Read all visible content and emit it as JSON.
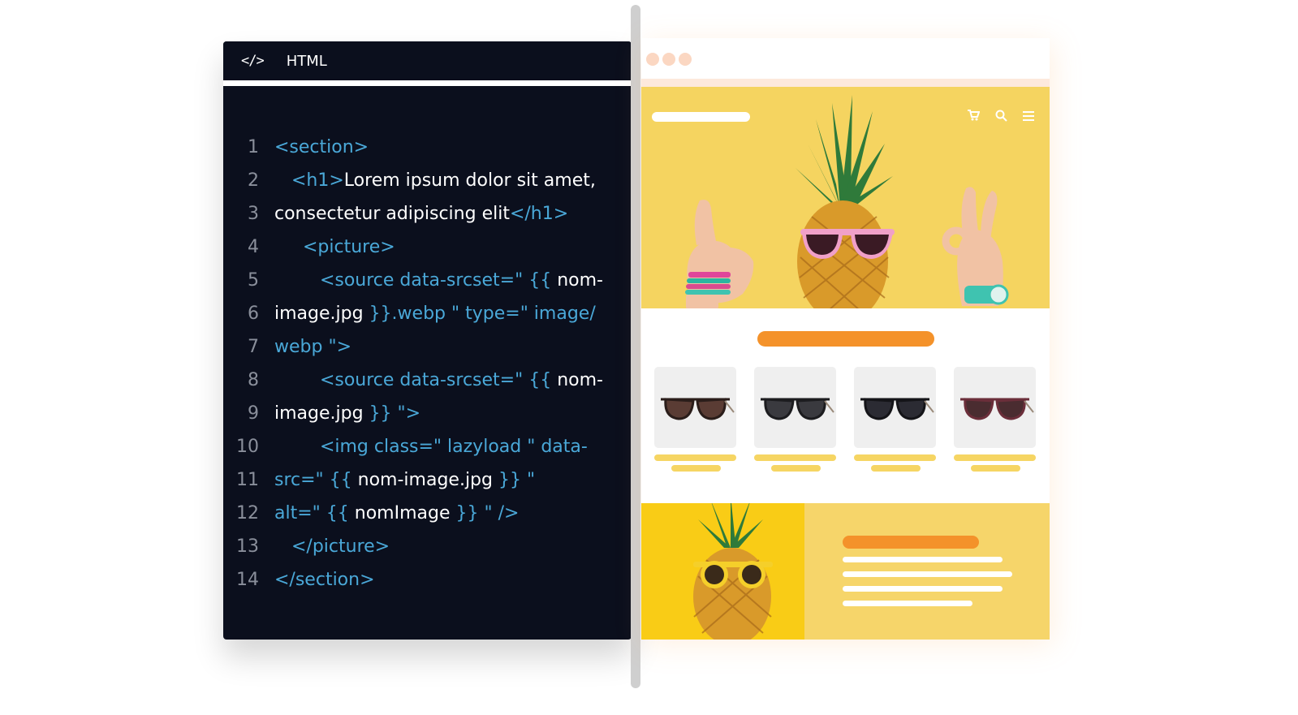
{
  "editor": {
    "icon": "code-icon",
    "title": "HTML",
    "lines": [
      {
        "num": "1",
        "parts": [
          {
            "cls": "t",
            "text": "<section>"
          }
        ]
      },
      {
        "num": "2",
        "parts": [
          {
            "cls": "t",
            "text": "   <h1>"
          },
          {
            "cls": "w",
            "text": "Lorem ipsum dolor sit amet,"
          }
        ]
      },
      {
        "num": "3",
        "parts": [
          {
            "cls": "w",
            "text": "consectetur adipiscing elit"
          },
          {
            "cls": "t",
            "text": "</h1>"
          }
        ]
      },
      {
        "num": "4",
        "parts": [
          {
            "cls": "t",
            "text": "     <picture>"
          }
        ]
      },
      {
        "num": "5",
        "parts": [
          {
            "cls": "t",
            "text": "        <source data-srcset=\" {{ "
          },
          {
            "cls": "w",
            "text": "nom-"
          }
        ]
      },
      {
        "num": "6",
        "parts": [
          {
            "cls": "w",
            "text": "image.jpg "
          },
          {
            "cls": "t",
            "text": "}}.webp \" type=\" image/"
          }
        ]
      },
      {
        "num": "7",
        "parts": [
          {
            "cls": "t",
            "text": "webp \">"
          }
        ]
      },
      {
        "num": "8",
        "parts": [
          {
            "cls": "t",
            "text": "        <source data-srcset=\" {{ "
          },
          {
            "cls": "w",
            "text": "nom-"
          }
        ]
      },
      {
        "num": "9",
        "parts": [
          {
            "cls": "w",
            "text": "image.jpg "
          },
          {
            "cls": "t",
            "text": "}} \">"
          }
        ]
      },
      {
        "num": "10",
        "parts": [
          {
            "cls": "t",
            "text": "        <img class=\" lazyload \" data-"
          }
        ]
      },
      {
        "num": "11",
        "parts": [
          {
            "cls": "t",
            "text": "src=\" {{ "
          },
          {
            "cls": "w",
            "text": "nom-image.jpg "
          },
          {
            "cls": "t",
            "text": "}} \""
          }
        ]
      },
      {
        "num": "12",
        "parts": [
          {
            "cls": "t",
            "text": "alt=\" {{ "
          },
          {
            "cls": "w",
            "text": "nomImage "
          },
          {
            "cls": "t",
            "text": "}} \" />"
          }
        ]
      },
      {
        "num": "13",
        "parts": [
          {
            "cls": "t",
            "text": "   </picture>"
          }
        ]
      },
      {
        "num": "14",
        "parts": [
          {
            "cls": "t",
            "text": "</section>"
          }
        ]
      }
    ]
  },
  "preview": {
    "nav_icons": [
      "cart-icon",
      "search-icon",
      "menu-icon"
    ],
    "colors": {
      "hero_bg": "#f5d460",
      "accent": "#f4922a",
      "product_bg": "#efefef",
      "placeholder_bar": "#f6d563",
      "editor_bg": "#0b0f1d",
      "tag_color": "#4aa8d8"
    },
    "products": [
      {
        "icon": "sunglasses-icon",
        "frame": "#2a1d1a",
        "lens": "#5a3c34"
      },
      {
        "icon": "sunglasses-icon",
        "frame": "#1c1c1f",
        "lens": "#3a3a3f"
      },
      {
        "icon": "sunglasses-icon",
        "frame": "#141418",
        "lens": "#2b2b33"
      },
      {
        "icon": "sunglasses-icon",
        "frame": "#6b2e3a",
        "lens": "#4a2c30"
      }
    ]
  }
}
